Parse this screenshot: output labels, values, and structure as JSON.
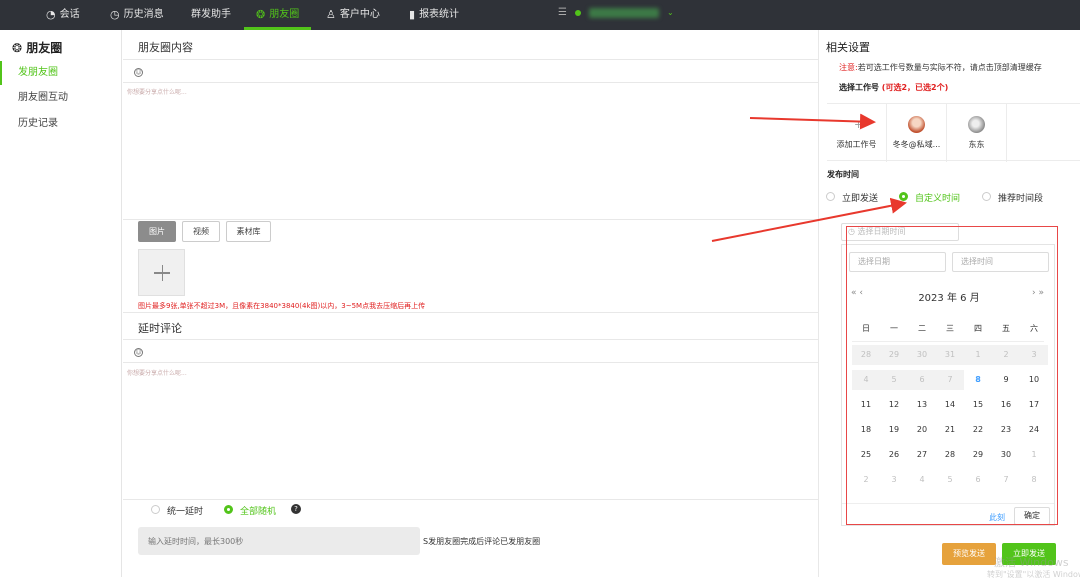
{
  "topnav": {
    "items": [
      {
        "label": "会话",
        "icon": "chat-icon"
      },
      {
        "label": "历史消息",
        "icon": "clock-icon"
      },
      {
        "label": "群发助手",
        "icon": ""
      },
      {
        "label": "朋友圈",
        "icon": "moments-icon",
        "active": true
      },
      {
        "label": "客户中心",
        "icon": "user-icon"
      },
      {
        "label": "报表统计",
        "icon": "bar-chart-icon"
      }
    ]
  },
  "sidebar": {
    "title": "朋友圈",
    "items": [
      {
        "label": "发朋友圈",
        "active": true
      },
      {
        "label": "朋友圈互动"
      },
      {
        "label": "历史记录"
      }
    ]
  },
  "main": {
    "content_title": "朋友圈内容",
    "content_placeholder": "你想要分享点什么呢...",
    "media_tabs": [
      "图片",
      "视频",
      "素材库"
    ],
    "upload_hint_red": "图片最多9张,单张不超过3M，且像素在3840*3840(4k图)以内，3~5M点我去压缩后再上传",
    "upload_hint_green": "",
    "comment_title": "延时评论",
    "comment_placeholder": "你想要分享点什么呢...",
    "delay_options": [
      {
        "label": "统一延时",
        "selected": false
      },
      {
        "label": "全部随机",
        "selected": true
      }
    ],
    "help_icon": "?",
    "delay_placeholder": "输入延时时间，最长300秒",
    "delay_suffix": "S发朋友圈完成后评论已发朋友圈"
  },
  "right": {
    "title": "相关设置",
    "notice_label": "注意:",
    "notice_text": "若可选工作号数量与实际不符，请点击顶部清理缓存",
    "pick_label": "选择工作号",
    "pick_status": "(可选2，已选2个)",
    "pick_close": ")",
    "accounts": [
      {
        "label": "添加工作号"
      },
      {
        "label": "冬冬@私域..."
      },
      {
        "label": "东东"
      }
    ],
    "publish_label": "发布时间",
    "publish_options": [
      {
        "label": "立即发送",
        "selected": false
      },
      {
        "label": "自定义时间",
        "selected": true
      },
      {
        "label": "推荐时间段",
        "selected": false
      }
    ],
    "datetime_placeholder": "选择日期时间",
    "picker": {
      "date_placeholder": "选择日期",
      "time_placeholder": "选择时间",
      "nav_prev": "« ‹",
      "nav_next": "› »",
      "header": "2023 年  6 月",
      "weekdays": [
        "日",
        "一",
        "二",
        "三",
        "四",
        "五",
        "六"
      ],
      "weeks": [
        [
          "28",
          "29",
          "30",
          "31",
          "1",
          "2",
          "3"
        ],
        [
          "4",
          "5",
          "6",
          "7",
          "8",
          "9",
          "10"
        ],
        [
          "11",
          "12",
          "13",
          "14",
          "15",
          "16",
          "17"
        ],
        [
          "18",
          "19",
          "20",
          "21",
          "22",
          "23",
          "24"
        ],
        [
          "25",
          "26",
          "27",
          "28",
          "29",
          "30",
          "1"
        ],
        [
          "2",
          "3",
          "4",
          "5",
          "6",
          "7",
          "8"
        ]
      ],
      "now_label": "此刻",
      "ok_label": "确定"
    },
    "preview_label": "预览发送",
    "send_label": "立即发送",
    "watermark": "激活 Windows",
    "watermark2": "转到\"设置\"以激活 Windows。"
  }
}
